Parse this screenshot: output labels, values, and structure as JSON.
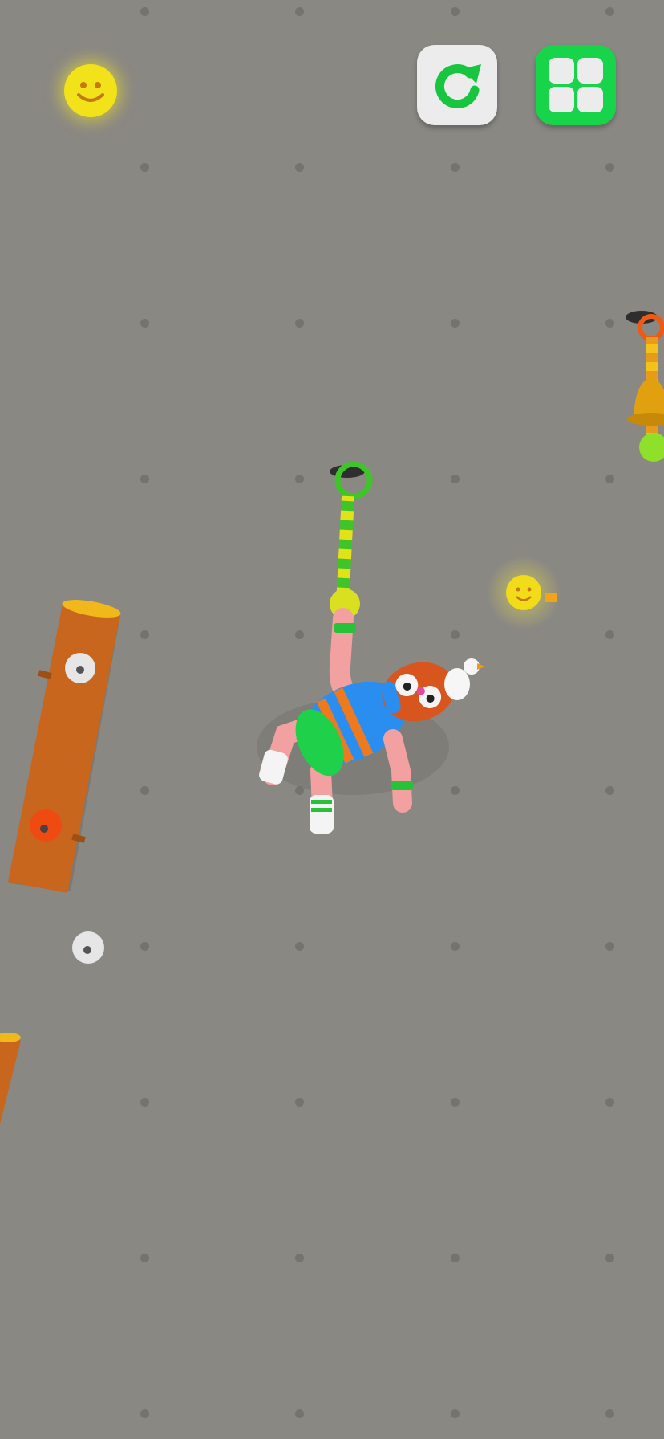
{
  "hud": {
    "score_icon": "smiley-coin-icon",
    "restart_icon": "restart-arrow-icon",
    "menu_icon": "grid-menu-icon"
  },
  "colors": {
    "background": "#8a8883",
    "restart_button": "#ececec",
    "menu_button": "#17d44a",
    "coin": "#f2e21a",
    "rope_green": "#3fc52a",
    "rope_yellow": "#e2e21a",
    "log": "#c8661e"
  },
  "scene": {
    "character": "ragdoll-climber",
    "collectible": "smiley-coin",
    "goal": "golden-bell"
  }
}
